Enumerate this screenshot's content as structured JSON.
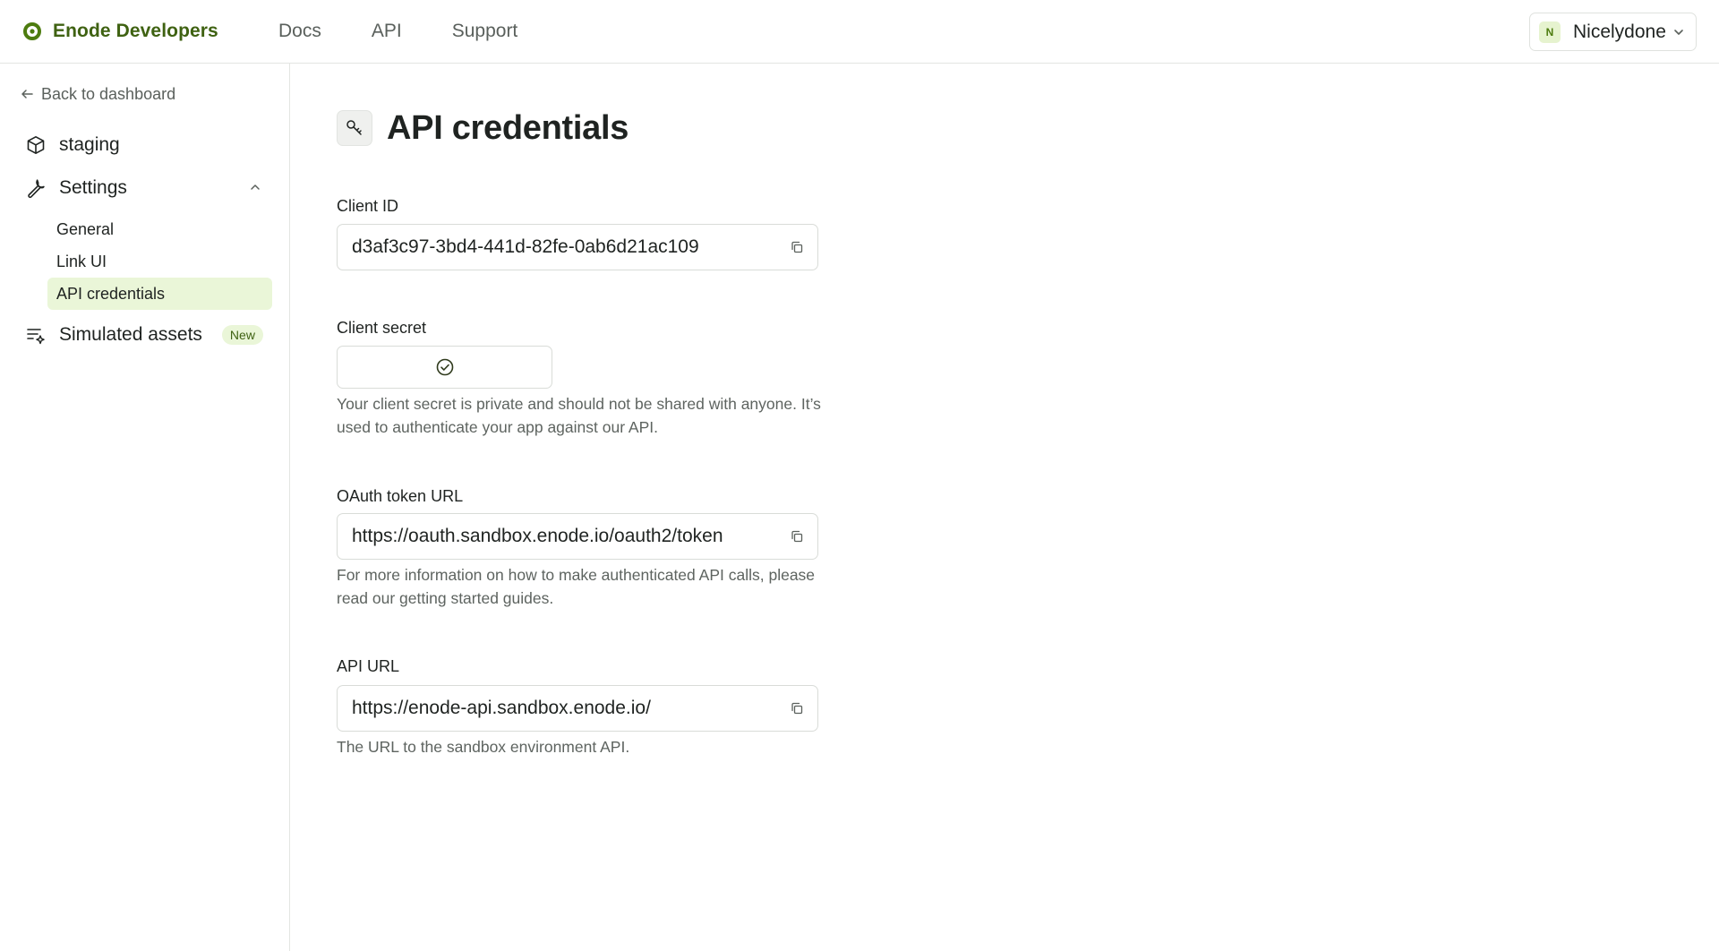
{
  "header": {
    "brand": "Enode Developers",
    "nav": [
      "Docs",
      "API",
      "Support"
    ],
    "account": {
      "initial": "N",
      "name": "Nicelydone"
    }
  },
  "sidebar": {
    "back_label": "Back to dashboard",
    "project": "staging",
    "settings_label": "Settings",
    "settings_items": [
      "General",
      "Link UI",
      "API credentials"
    ],
    "active_item": "API credentials",
    "simulated_label": "Simulated assets",
    "simulated_badge": "New"
  },
  "main": {
    "title": "API credentials",
    "client_id": {
      "label": "Client ID",
      "value": "d3af3c97-3bd4-441d-82fe-0ab6d21ac109"
    },
    "client_secret": {
      "label": "Client secret",
      "help": "Your client secret is private and should not be shared with anyone. It’s used to authenticate your app against our API."
    },
    "oauth_url": {
      "label": "OAuth token URL",
      "value": "https://oauth.sandbox.enode.io/oauth2/token",
      "help": "For more information on how to make authenticated API calls, please read our getting started guides."
    },
    "api_url": {
      "label": "API URL",
      "value": "https://enode-api.sandbox.enode.io/",
      "help": "The URL to the sandbox environment API."
    }
  },
  "colors": {
    "brand": "#3f6212",
    "active_bg": "#eaf6d8",
    "border": "#d9dcd8",
    "muted_text": "#5e6460"
  },
  "icons": [
    "enode-logo-icon",
    "chevron-down-icon",
    "arrow-left-icon",
    "cube-icon",
    "wrench-icon",
    "chevron-up-icon",
    "list-sparkle-icon",
    "key-icon",
    "copy-icon",
    "check-circle-icon"
  ]
}
